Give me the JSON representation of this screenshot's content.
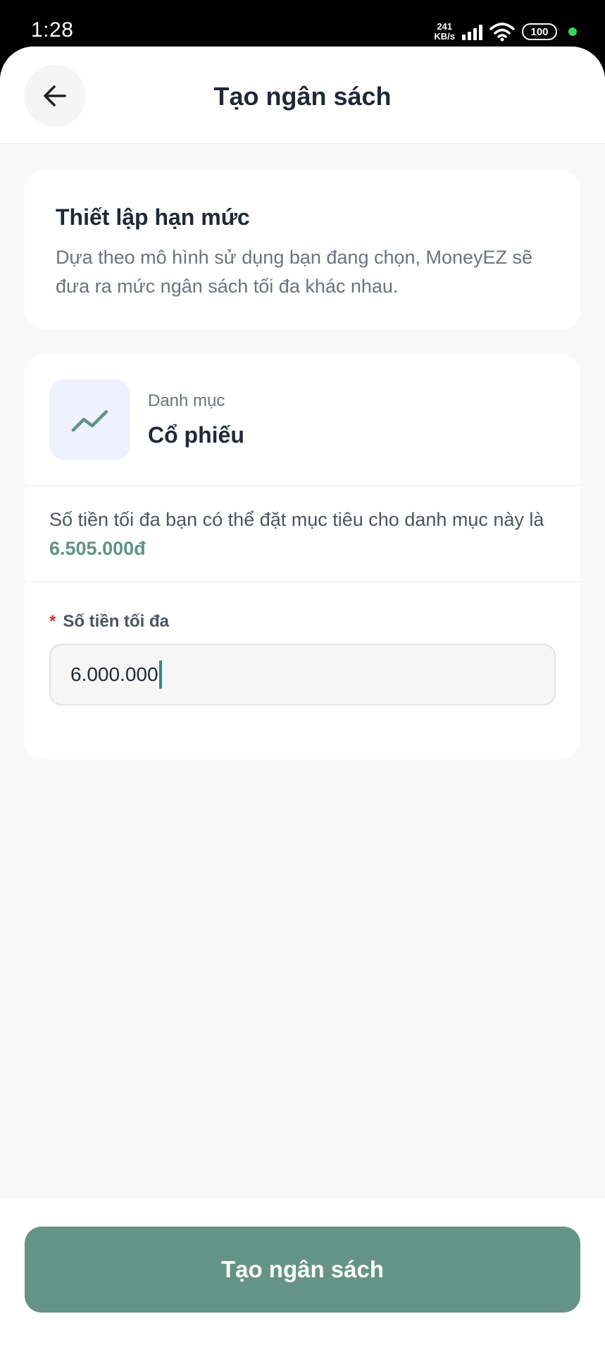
{
  "status_bar": {
    "time": "1:28",
    "net_speed_value": "241",
    "net_speed_unit": "KB/s",
    "battery": "100"
  },
  "header": {
    "title": "Tạo ngân sách",
    "back_icon": "arrow-left-icon"
  },
  "limit_card": {
    "title": "Thiết lập hạn mức",
    "description": "Dựa theo mô hình sử dụng bạn đang chọn, MoneyEZ sẽ đưa ra mức ngân sách tối đa khác nhau."
  },
  "category": {
    "label": "Danh mục",
    "value": "Cổ phiếu",
    "icon": "trending-up-icon"
  },
  "info": {
    "text": "Số tiền tối đa bạn có thể đặt mục tiêu cho danh mục này là",
    "amount": "6.505.000đ"
  },
  "max_amount_field": {
    "required_mark": "*",
    "label": "Số tiền tối đa",
    "value": "6.000.000"
  },
  "footer": {
    "submit_label": "Tạo ngân sách"
  },
  "colors": {
    "primary": "#659486",
    "accent_text": "#5f9385",
    "required": "#d03333",
    "icon_bg": "#edf2fd"
  }
}
